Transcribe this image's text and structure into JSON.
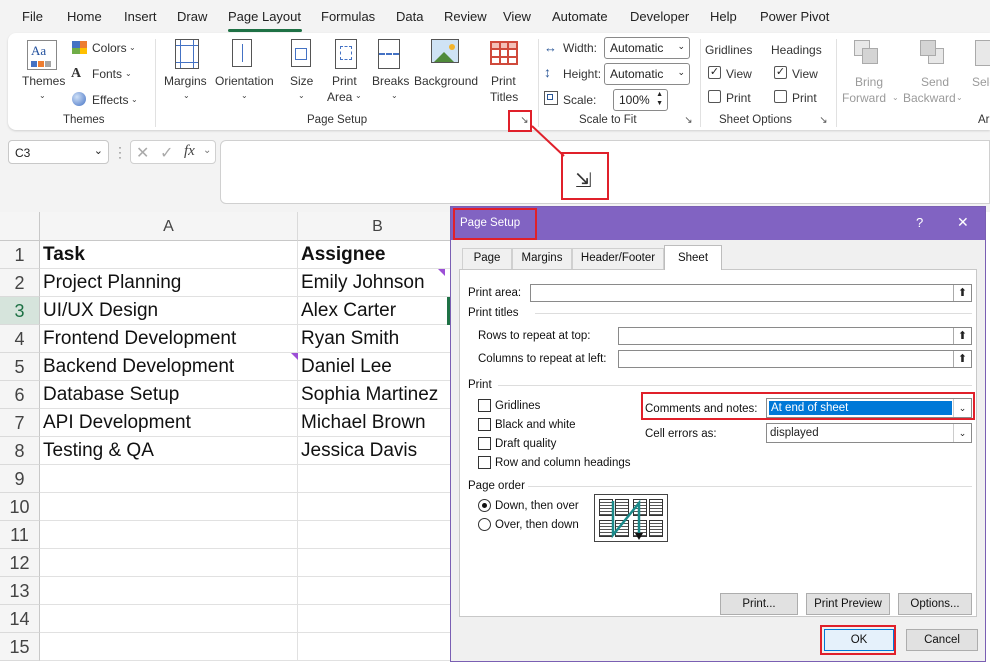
{
  "menu": {
    "tabs": [
      "File",
      "Home",
      "Insert",
      "Draw",
      "Page Layout",
      "Formulas",
      "Data",
      "Review",
      "View",
      "Automate",
      "Developer",
      "Help",
      "Power Pivot"
    ],
    "active": "Page Layout"
  },
  "ribbon": {
    "themes_group": {
      "themes_label": "Themes",
      "colors_label": "Colors",
      "fonts_label": "Fonts",
      "effects_label": "Effects",
      "group_label": "Themes"
    },
    "page_setup_group": {
      "margins": "Margins",
      "orientation": "Orientation",
      "size": "Size",
      "print_area_1": "Print",
      "print_area_2": "Area",
      "breaks": "Breaks",
      "background": "Background",
      "print_titles_1": "Print",
      "print_titles_2": "Titles",
      "group_label": "Page Setup"
    },
    "scale_group": {
      "width_label": "Width:",
      "width_value": "Automatic",
      "height_label": "Height:",
      "height_value": "Automatic",
      "scale_label": "Scale:",
      "scale_value": "100%",
      "group_label": "Scale to Fit"
    },
    "sheet_options_group": {
      "gridlines": "Gridlines",
      "headings": "Headings",
      "view": "View",
      "print": "Print",
      "group_label": "Sheet Options"
    },
    "arrange_group": {
      "bring_1": "Bring",
      "bring_2": "Forward",
      "send_1": "Send",
      "send_2": "Backward",
      "sele": "Sele",
      "ar": "Ar"
    }
  },
  "formula_bar": {
    "name_box": "C3",
    "fx": "fx"
  },
  "sheet": {
    "columns": [
      "A",
      "B"
    ],
    "rows": [
      "1",
      "2",
      "3",
      "4",
      "5",
      "6",
      "7",
      "8",
      "9",
      "10",
      "11",
      "12",
      "13",
      "14",
      "15"
    ],
    "data": [
      [
        "Task",
        "Assignee"
      ],
      [
        "Project Planning",
        "Emily Johnson"
      ],
      [
        "UI/UX Design",
        "Alex Carter"
      ],
      [
        "Frontend Development",
        "Ryan Smith"
      ],
      [
        "Backend Development",
        "Daniel Lee"
      ],
      [
        "Database Setup",
        "Sophia Martinez"
      ],
      [
        "API Development",
        "Michael Brown"
      ],
      [
        "Testing & QA",
        "Jessica Davis"
      ]
    ]
  },
  "dialog": {
    "title": "Page Setup",
    "help": "?",
    "close": "✕",
    "tabs": [
      "Page",
      "Margins",
      "Header/Footer",
      "Sheet"
    ],
    "active_tab": "Sheet",
    "print_area_label": "Print area:",
    "print_titles_label": "Print titles",
    "rows_repeat_label": "Rows to repeat at top:",
    "cols_repeat_label": "Columns to repeat at left:",
    "print_label": "Print",
    "gridlines": "Gridlines",
    "black_white": "Black and white",
    "draft_quality": "Draft quality",
    "row_col_headings": "Row and column headings",
    "comments_label": "Comments and notes:",
    "comments_value": "At end of sheet",
    "cell_errors_label": "Cell errors as:",
    "cell_errors_value": "displayed",
    "page_order_label": "Page order",
    "down_then_over": "Down, then over",
    "over_then_down": "Over, then down",
    "print_btn": "Print...",
    "print_preview_btn": "Print Preview",
    "options_btn": "Options...",
    "ok_btn": "OK",
    "cancel_btn": "Cancel"
  },
  "colors": {
    "accent_green": "#1e7145",
    "dialog_title": "#8163c2",
    "highlight": "#e0202a",
    "selection_blue": "#0078d7"
  }
}
